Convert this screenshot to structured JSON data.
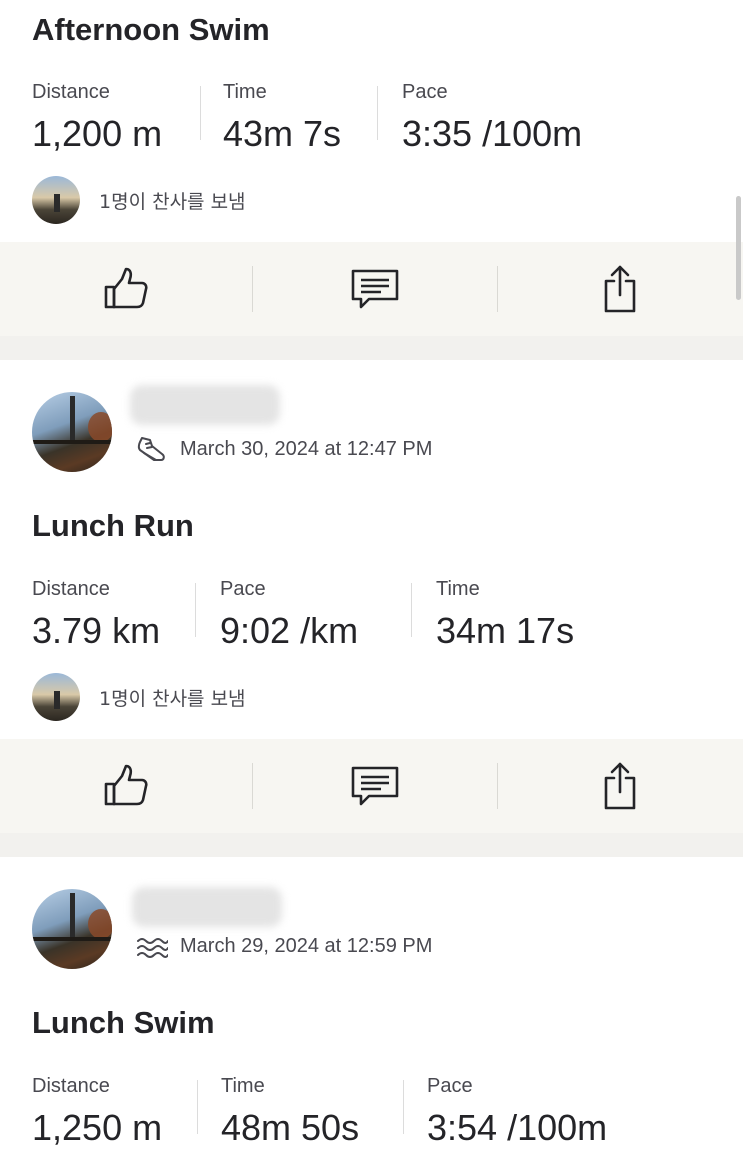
{
  "feed": {
    "activities": [
      {
        "title": "Afternoon Swim",
        "stats": [
          {
            "label": "Distance",
            "value": "1,200 m"
          },
          {
            "label": "Time",
            "value": "43m 7s"
          },
          {
            "label": "Pace",
            "value": "3:35 /100m"
          }
        ],
        "kudos_text": "1명이 찬사를 보냄"
      },
      {
        "date": "March 30, 2024 at 12:47 PM",
        "sport_icon": "run-shoe-icon",
        "title": "Lunch Run",
        "stats": [
          {
            "label": "Distance",
            "value": "3.79 km"
          },
          {
            "label": "Pace",
            "value": "9:02 /km"
          },
          {
            "label": "Time",
            "value": "34m 17s"
          }
        ],
        "kudos_text": "1명이 찬사를 보냄"
      },
      {
        "date": "March 29, 2024 at 12:59 PM",
        "sport_icon": "swim-waves-icon",
        "title": "Lunch Swim",
        "stats": [
          {
            "label": "Distance",
            "value": "1,250 m"
          },
          {
            "label": "Time",
            "value": "48m 50s"
          },
          {
            "label": "Pace",
            "value": "3:54 /100m"
          }
        ]
      }
    ]
  },
  "actions": {
    "icons": [
      "thumbs-up-icon",
      "comment-icon",
      "share-icon"
    ]
  },
  "colors": {
    "accent": "#fc5200",
    "text_primary": "#242428",
    "text_secondary": "#494950",
    "action_bar_bg": "#f7f6f2",
    "feed_gap_bg": "#f2f1ee"
  }
}
